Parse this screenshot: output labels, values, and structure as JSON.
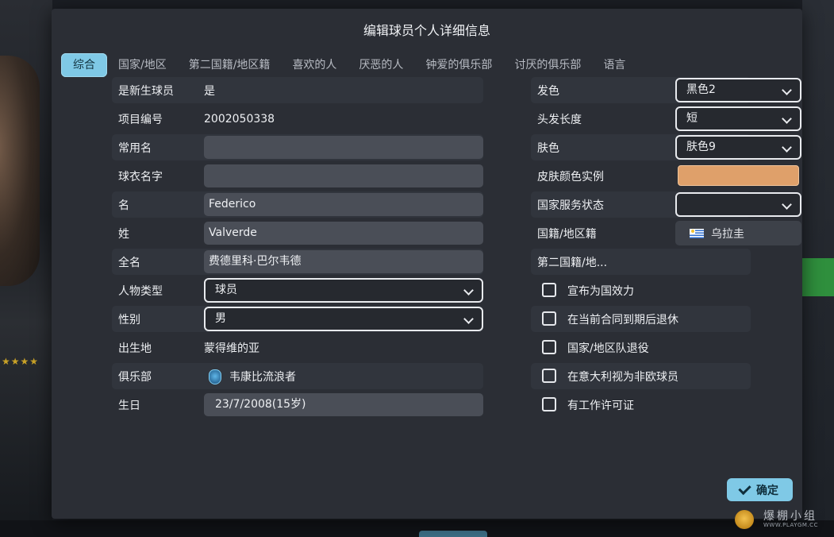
{
  "dialog": {
    "title": "编辑球员个人详细信息"
  },
  "tabs": [
    {
      "label": "综合"
    },
    {
      "label": "国家/地区"
    },
    {
      "label": "第二国籍/地区籍"
    },
    {
      "label": "喜欢的人"
    },
    {
      "label": "厌恶的人"
    },
    {
      "label": "钟爱的俱乐部"
    },
    {
      "label": "讨厌的俱乐部"
    },
    {
      "label": "语言"
    }
  ],
  "left": {
    "newgen": {
      "label": "是新生球员",
      "value": "是"
    },
    "unique_id": {
      "label": "项目编号",
      "value": "2002050338"
    },
    "common_name": {
      "label": "常用名",
      "value": ""
    },
    "shirt_name": {
      "label": "球衣名字",
      "value": ""
    },
    "first_name": {
      "label": "名",
      "value": "Federico"
    },
    "last_name": {
      "label": "姓",
      "value": "Valverde"
    },
    "full_name": {
      "label": "全名",
      "value": "费德里科·巴尔韦德"
    },
    "person_type": {
      "label": "人物类型",
      "value": "球员"
    },
    "gender": {
      "label": "性别",
      "value": "男"
    },
    "birthplace": {
      "label": "出生地",
      "value": "蒙得维的亚"
    },
    "club": {
      "label": "俱乐部",
      "value": "韦康比流浪者"
    },
    "birthday": {
      "label": "生日",
      "value": "23/7/2008(15岁)"
    }
  },
  "right": {
    "hair_color": {
      "label": "发色",
      "value": "黑色2"
    },
    "hair_length": {
      "label": "头发长度",
      "value": "短"
    },
    "skin_tone": {
      "label": "肤色",
      "value": "肤色9"
    },
    "skin_sample": {
      "label": "皮肤颜色实例",
      "color": "#dfa06a"
    },
    "national_service": {
      "label": "国家服务状态",
      "value": ""
    },
    "nationality": {
      "label": "国籍/地区籍",
      "value": "乌拉圭"
    },
    "second_nationality": {
      "label": "第二国籍/地..."
    },
    "checkboxes": [
      {
        "label": "宣布为国效力",
        "checked": false
      },
      {
        "label": "在当前合同到期后退休",
        "checked": false
      },
      {
        "label": "国家/地区队退役",
        "checked": false
      },
      {
        "label": "在意大利视为非欧球员",
        "checked": false
      },
      {
        "label": "有工作许可证",
        "checked": false
      }
    ]
  },
  "confirm": {
    "label": "确定"
  },
  "watermark": {
    "text": "爆棚小组",
    "url": "WWW.PLAYGM.CC"
  },
  "colors": {
    "accent": "#7fc9e6",
    "panel": "#2b2e35",
    "input": "#4a4e57"
  }
}
